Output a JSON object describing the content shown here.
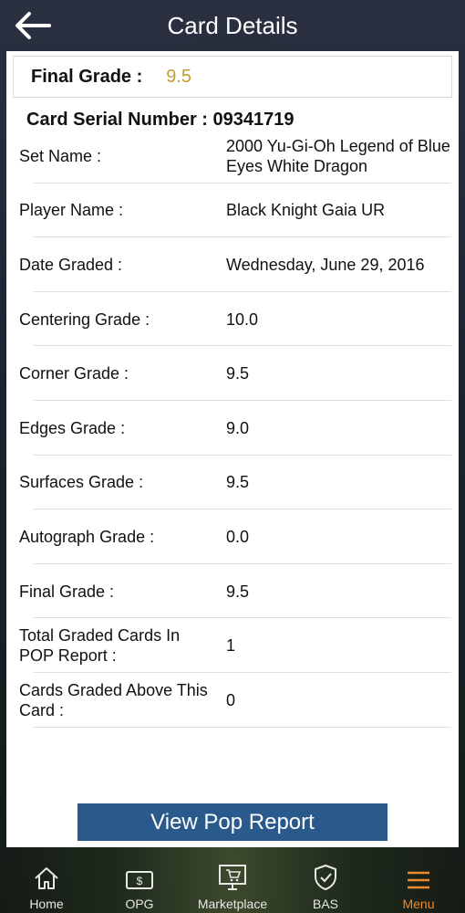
{
  "header": {
    "title": "Card Details"
  },
  "final_grade": {
    "label": "Final Grade :",
    "value": "9.5"
  },
  "serial": {
    "text": "Card Serial Number : 09341719"
  },
  "details": [
    {
      "label": "Set Name :",
      "value": "2000 Yu-Gi-Oh Legend of Blue Eyes White Dragon"
    },
    {
      "label": "Player Name :",
      "value": "Black Knight Gaia UR"
    },
    {
      "label": "Date Graded :",
      "value": "Wednesday, June 29, 2016"
    },
    {
      "label": "Centering Grade :",
      "value": "10.0"
    },
    {
      "label": "Corner Grade :",
      "value": "9.5"
    },
    {
      "label": "Edges Grade :",
      "value": "9.0"
    },
    {
      "label": "Surfaces Grade :",
      "value": "9.5"
    },
    {
      "label": "Autograph Grade :",
      "value": "0.0"
    },
    {
      "label": "Final Grade :",
      "value": "9.5"
    },
    {
      "label": "Total Graded Cards In POP Report :",
      "value": "1"
    },
    {
      "label": "Cards Graded Above This Card :",
      "value": "0"
    }
  ],
  "button": {
    "label": "View Pop Report"
  },
  "tabs": [
    {
      "label": "Home",
      "icon": "home-icon"
    },
    {
      "label": "OPG",
      "icon": "money-icon"
    },
    {
      "label": "Marketplace",
      "icon": "marketplace-icon"
    },
    {
      "label": "BAS",
      "icon": "shield-check-icon"
    },
    {
      "label": "Menu",
      "icon": "menu-icon"
    }
  ],
  "colors": {
    "accent_gold": "#c39b2f",
    "button_blue": "#2a5a8c",
    "active_tab": "#f08a2a"
  }
}
